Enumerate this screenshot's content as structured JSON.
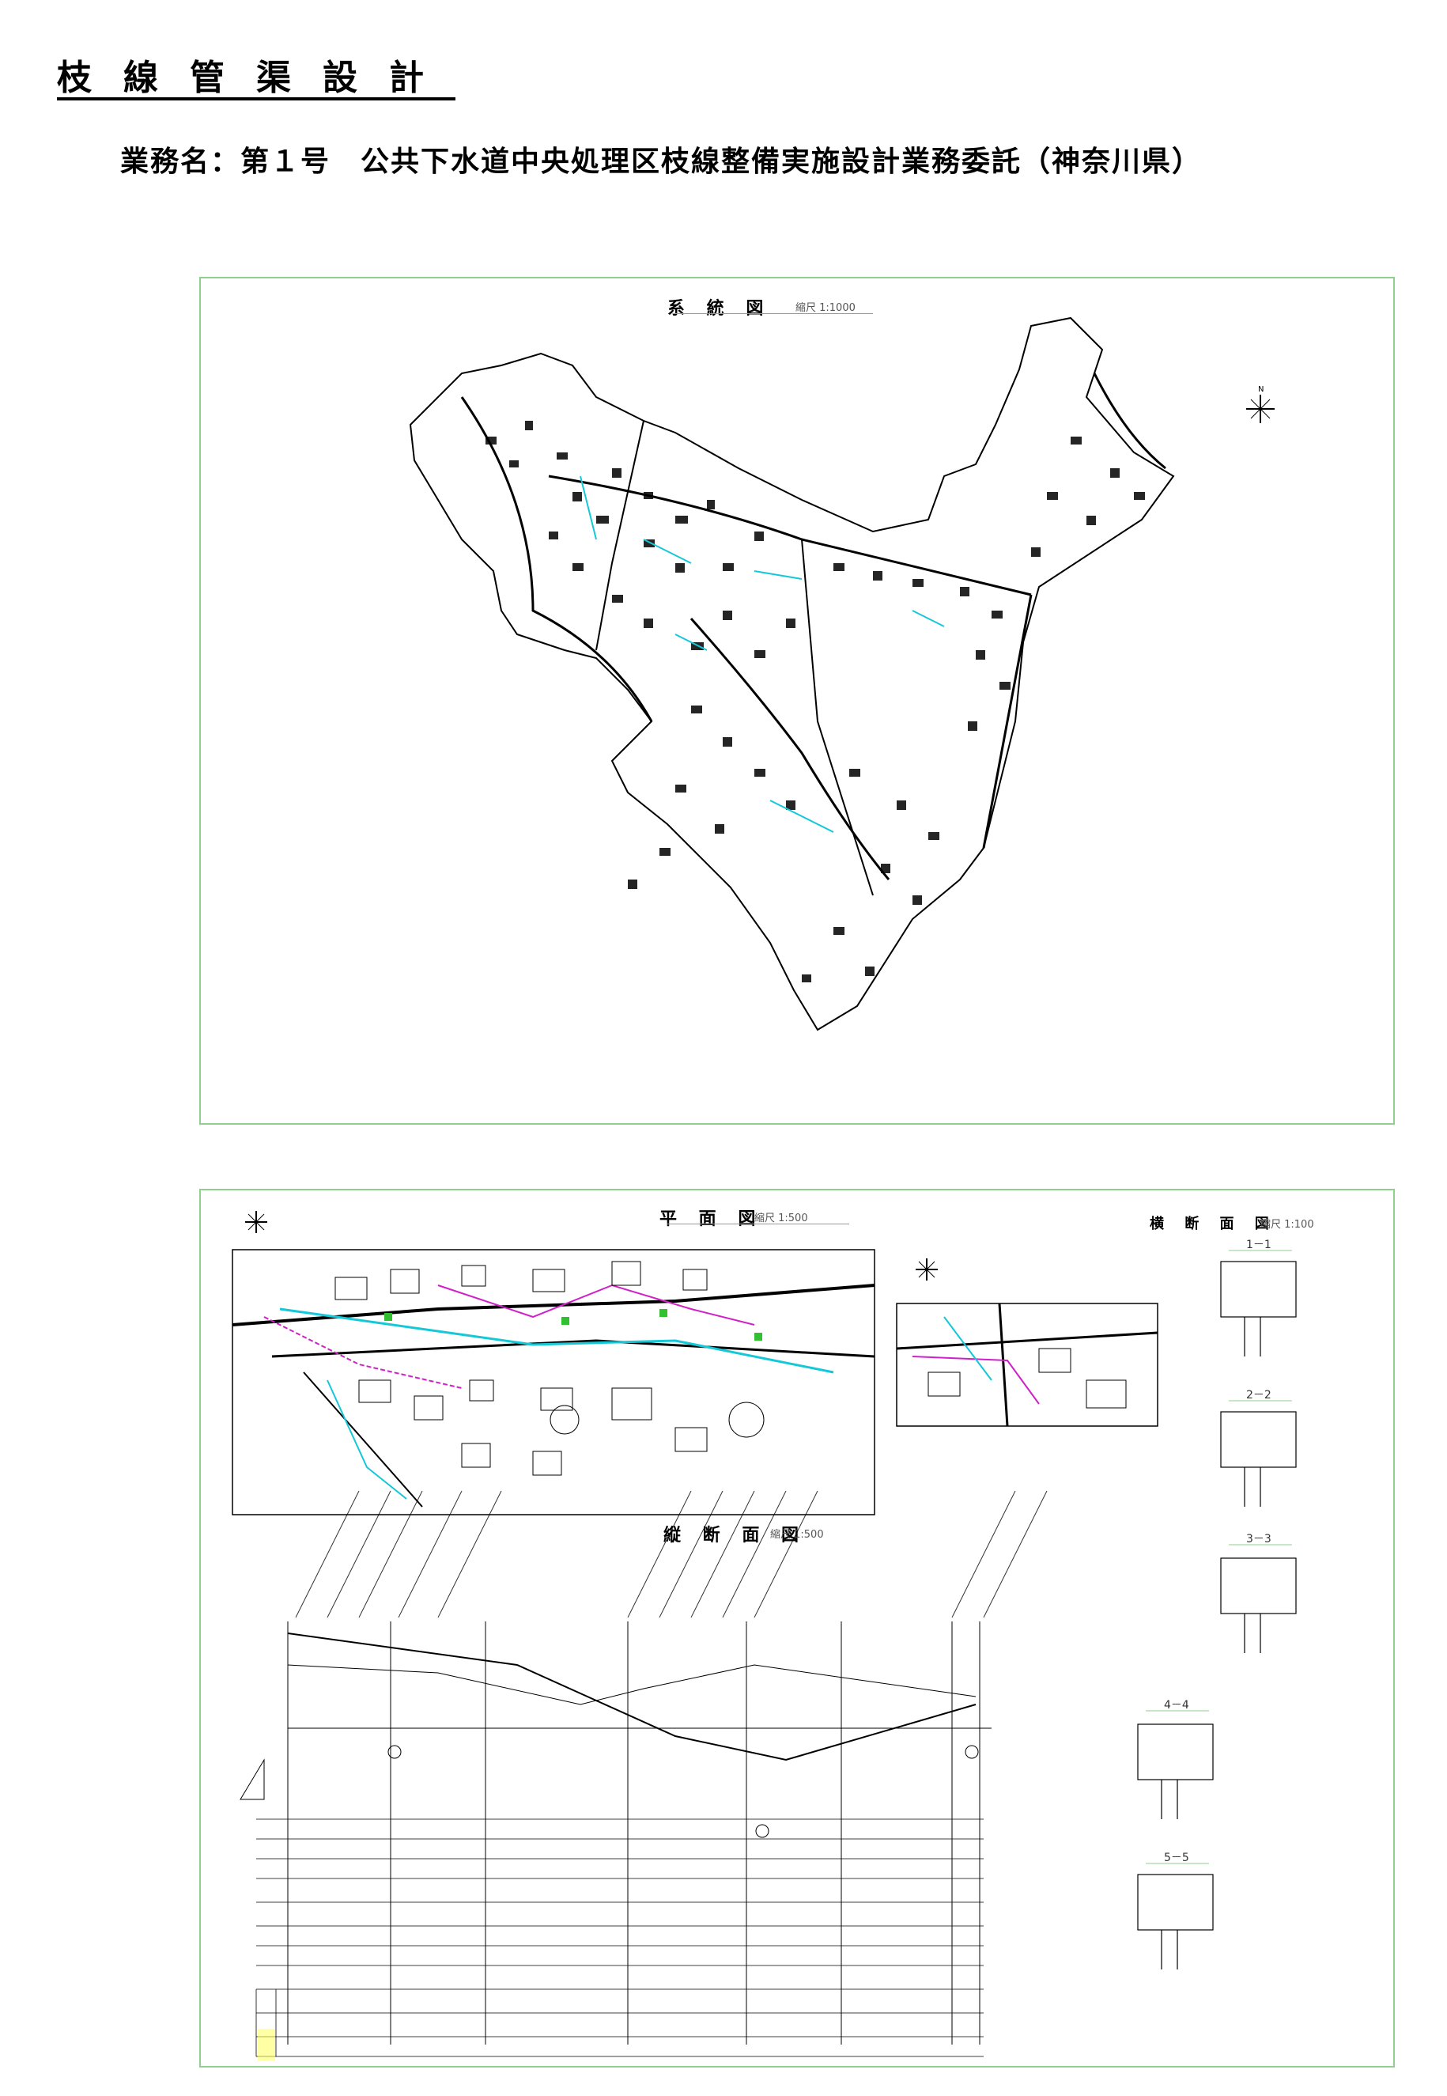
{
  "header": {
    "title": "枝線管渠設計",
    "subtitle": "業務名：第１号　公共下水道中央処理区枝線整備実施設計業務委託（神奈川県）"
  },
  "sheet1": {
    "label": "系 統 図",
    "scale": "縮尺 1:1000"
  },
  "sheet2": {
    "plan_label": "平 面 図",
    "plan_scale": "縮尺 1:500",
    "cross_label": "横 断 面 図",
    "cross_scale": "縮尺 1:100",
    "profile_label": "縦 断 面 図",
    "profile_scale": "縮尺 1:500",
    "sections": [
      "1－1",
      "2－2",
      "3－3",
      "4－4",
      "5－5"
    ]
  },
  "colors": {
    "frame": "#8fd08f",
    "pipe_cyan": "#14c8d8",
    "pipe_magenta": "#d020c8",
    "pipe_green": "#30c030"
  }
}
